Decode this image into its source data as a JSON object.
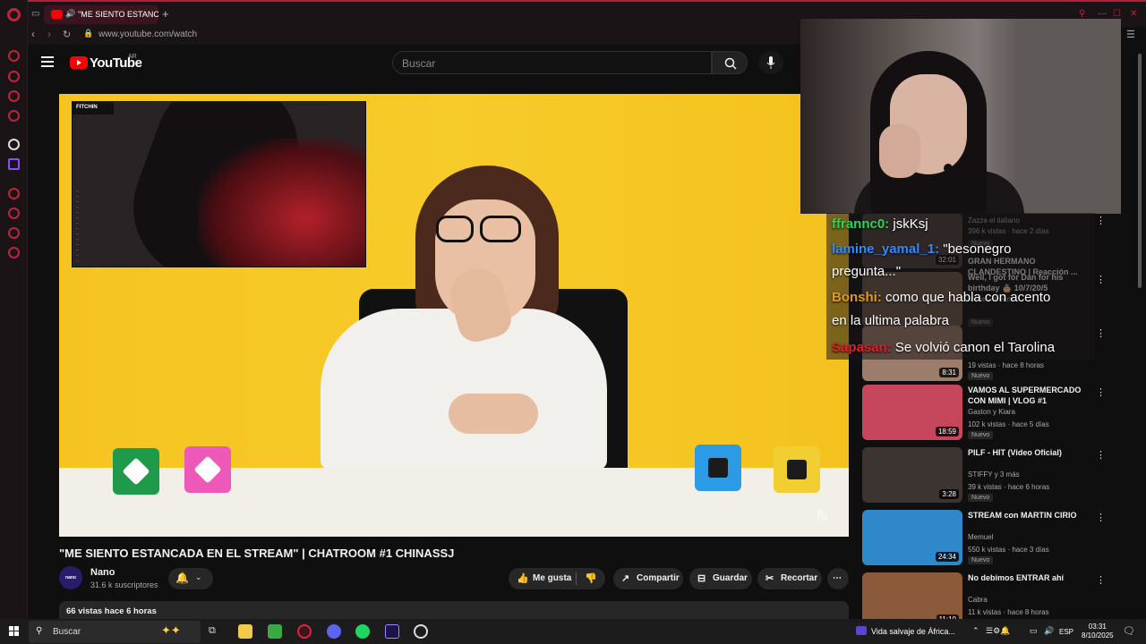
{
  "browser": {
    "tab_title": "\"ME SIENTO ESTANCA",
    "url": "www.youtube.com/watch"
  },
  "youtube": {
    "logo_text": "YouTube",
    "country": "AR",
    "search_placeholder": "Buscar"
  },
  "video": {
    "title": "\"ME SIENTO ESTANCADA EN EL STREAM\" | CHATROOM #1 CHINASSJ",
    "channel": "Nano",
    "channel_avatar_text": "nano",
    "subscribers": "31.6 k suscriptores",
    "views_date": "66 vistas  hace 6 horas",
    "overlay_label": "FITCHIN",
    "overlay_log": [
      "...",
      "...",
      "...",
      "...",
      "...",
      "...",
      "...",
      "...",
      "...",
      "...",
      "...",
      "...",
      "...",
      "..."
    ]
  },
  "actions": {
    "like": "Me gusta",
    "share": "Compartir",
    "save": "Guardar",
    "clip": "Recortar",
    "more": "⋯"
  },
  "chat": [
    {
      "user": "ffrannc0:",
      "message": "jskKsj",
      "color": "#2fd45c"
    },
    {
      "user": "lamine_yamal_1:",
      "message": "\"besonegro",
      "color": "#2e8cff"
    },
    {
      "user": "",
      "message": "pregunta...\"",
      "color": "#ffffff"
    },
    {
      "user": "Bonshi:",
      "message": "como que habla con acento",
      "color": "#e39b1e"
    },
    {
      "user": "",
      "message": "en la ultima palabra",
      "color": "#ffffff"
    },
    {
      "user": "Sapasan:",
      "message": "Se volvió canon el Tarolina",
      "color": "#e0202a"
    }
  ],
  "recommendations": [
    {
      "title": "GRAN HERMANO CLANDESTINO | Reacción ...",
      "channel": "Zazza el italiano",
      "meta": "396 k vistas · hace 2 días",
      "badge": "Nuevo",
      "duration": "32:01",
      "thumb": "#4a3a3a"
    },
    {
      "title": "Well, I got for Dan for his birthday 🎂 10/7/20/5",
      "channel": "Melian streams",
      "meta": "",
      "badge": "Nuevo",
      "duration": "",
      "thumb": "#6a5548"
    },
    {
      "title": "",
      "channel": "",
      "meta": "19 vistas · hace 8 horas",
      "badge": "Nuevo",
      "duration": "8:31",
      "thumb": "#9c7c6a"
    },
    {
      "title": "VAMOS AL SUPERMERCADO CON MIMI | VLOG #1",
      "channel": "Gaston y Kiara",
      "meta": "102 k vistas · hace 5 días",
      "badge": "Nuevo",
      "duration": "18:59",
      "thumb": "#c6465b"
    },
    {
      "title": "PILF - HIT (Video Oficial)",
      "channel": "STIFFY y 3 más",
      "meta": "39 k vistas · hace 6 horas",
      "badge": "Nuevo",
      "duration": "3:28",
      "thumb": "#3b3430"
    },
    {
      "title": "STREAM con MARTIN CIRIO",
      "channel": "Memuel",
      "meta": "550 k vistas · hace 3 días",
      "badge": "Nuevo",
      "duration": "24:34",
      "thumb": "#2f88c9"
    },
    {
      "title": "No debimos ENTRAR ahí",
      "channel": "Cabra",
      "meta": "11 k vistas · hace 8 horas",
      "badge": "Nuevo",
      "duration": "11:10",
      "thumb": "#8a5a3a"
    }
  ],
  "taskbar": {
    "search": "Buscar",
    "notice": "Vida salvaje de África...",
    "language": "ESP",
    "time": "03:31",
    "date": "8/10/2025"
  }
}
